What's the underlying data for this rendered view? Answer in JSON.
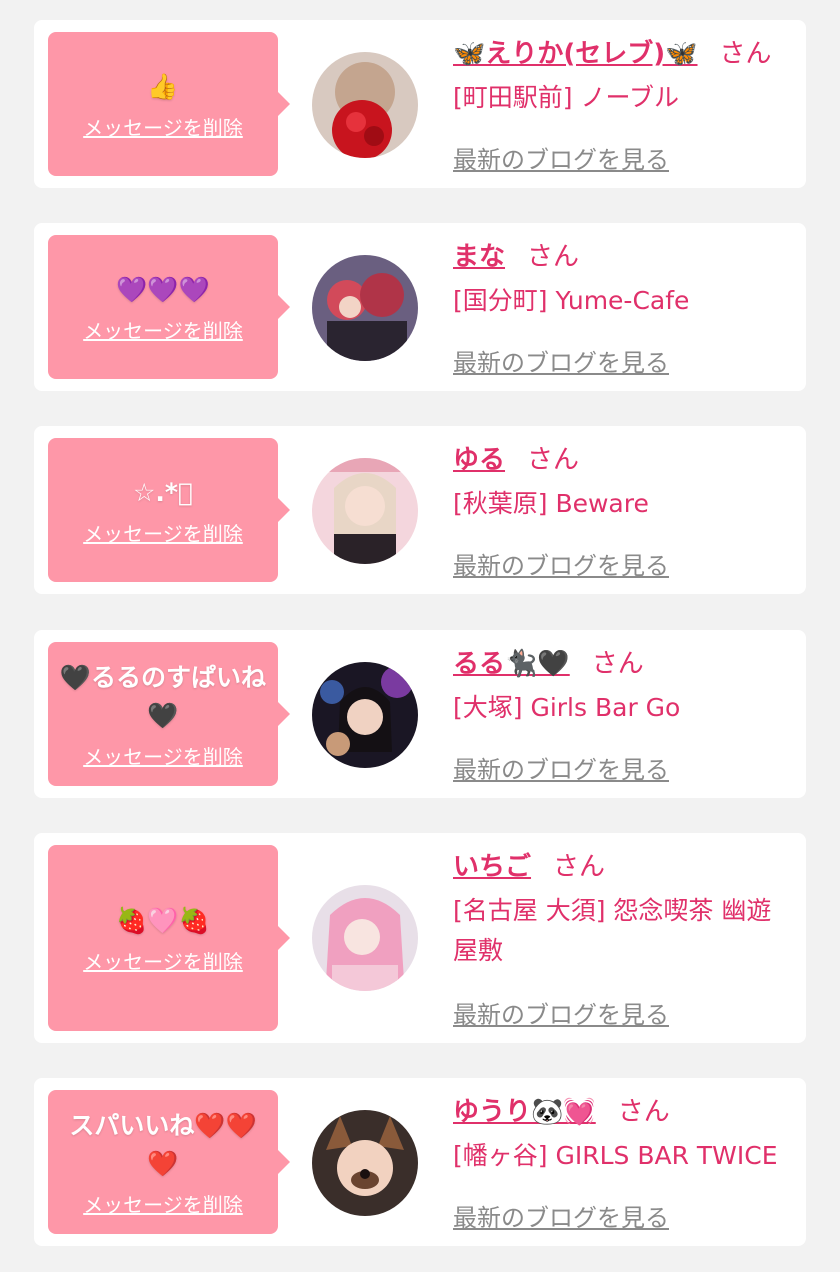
{
  "colors": {
    "accent_pink": "#fe97a8",
    "name_pink": "#e0306a",
    "link_gray": "#8a8a8a",
    "page_bg": "#f2f2f2"
  },
  "common": {
    "delete_label": "メッセージを削除",
    "honorific": "さん",
    "blog_link": "最新のブログを見る"
  },
  "messages": [
    {
      "message": "👍",
      "name": "🦋えりか(セレブ)🦋",
      "shop": "[町田駅前] ノーブル"
    },
    {
      "message": "💜💜💜",
      "name": "まな",
      "shop": "[国分町] Yume-Cafe"
    },
    {
      "message": "☆.*ﾟ",
      "name": "ゆる",
      "shop": "[秋葉原] Beware"
    },
    {
      "message": "🖤るるのすぱいね🖤",
      "name": "るる🐈‍⬛🖤",
      "shop": "[大塚] Girls Bar Go"
    },
    {
      "message": "🍓🩷🍓",
      "name": "いちご",
      "shop": "[名古屋 大須] 怨念喫茶 幽遊屋敷"
    },
    {
      "message": "スパいいね❤️❤️❤️",
      "name": "ゆうり🐼💓",
      "shop": "[幡ヶ谷] GIRLS BAR TWICE"
    }
  ]
}
